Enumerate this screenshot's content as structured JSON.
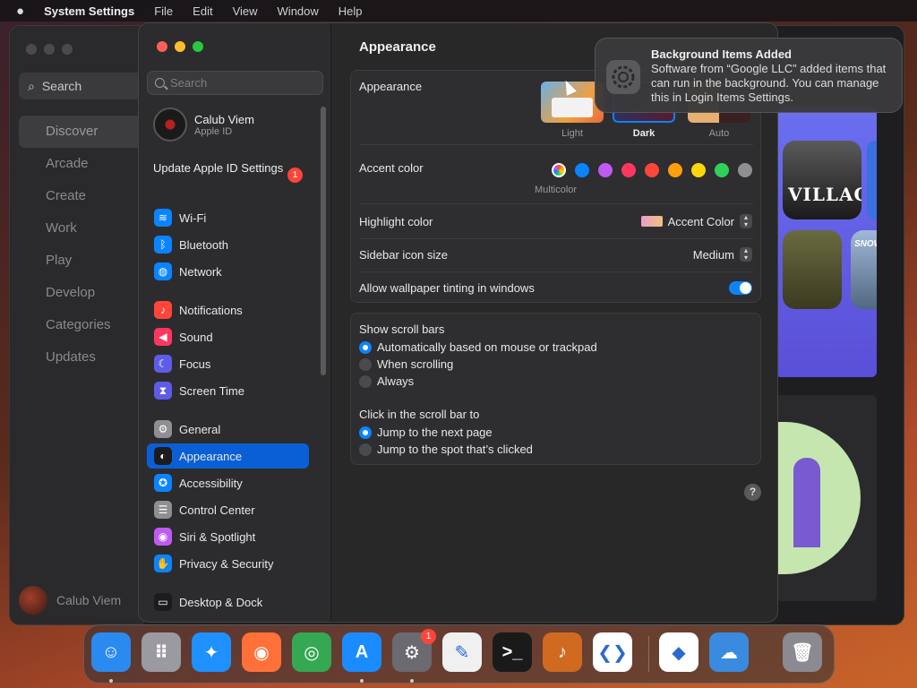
{
  "menubar": {
    "app_name": "System Settings",
    "items": [
      "File",
      "Edit",
      "View",
      "Window",
      "Help"
    ]
  },
  "store": {
    "search_label": "Search",
    "nav": [
      "Discover",
      "Arcade",
      "Create",
      "Work",
      "Play",
      "Develop",
      "Categories",
      "Updates"
    ],
    "active": "Discover",
    "user_name": "Calub Viem",
    "tile_village": "VILLAGE",
    "tile_snow": "SNOW"
  },
  "sidebar": {
    "search_placeholder": "Search",
    "user_name": "Calub Viem",
    "user_sub": "Apple ID",
    "update_label": "Update Apple ID Settings",
    "update_badge": "1",
    "items": [
      {
        "label": "Wi-Fi",
        "icon": "wifi-icon",
        "color": "#0a84ff"
      },
      {
        "label": "Bluetooth",
        "icon": "bluetooth-icon",
        "color": "#0a84ff"
      },
      {
        "label": "Network",
        "icon": "globe-icon",
        "color": "#0a84ff"
      },
      {
        "label": "Notifications",
        "icon": "bell-icon",
        "color": "#ff453a"
      },
      {
        "label": "Sound",
        "icon": "speaker-icon",
        "color": "#ff375f"
      },
      {
        "label": "Focus",
        "icon": "moon-icon",
        "color": "#5e5ce6"
      },
      {
        "label": "Screen Time",
        "icon": "hourglass-icon",
        "color": "#5e5ce6"
      },
      {
        "label": "General",
        "icon": "gear-icon",
        "color": "#8e8e93"
      },
      {
        "label": "Appearance",
        "icon": "appearance-icon",
        "color": "#1c1c1e"
      },
      {
        "label": "Accessibility",
        "icon": "accessibility-icon",
        "color": "#0a84ff"
      },
      {
        "label": "Control Center",
        "icon": "control-center-icon",
        "color": "#8e8e93"
      },
      {
        "label": "Siri & Spotlight",
        "icon": "siri-icon",
        "color": "#bf5af2"
      },
      {
        "label": "Privacy & Security",
        "icon": "hand-icon",
        "color": "#0a84ff"
      },
      {
        "label": "Desktop & Dock",
        "icon": "dock-icon",
        "color": "#1c1c1e"
      }
    ],
    "selected": "Appearance"
  },
  "content": {
    "title": "Appearance",
    "appearance_label": "Appearance",
    "themes": [
      "Light",
      "Dark",
      "Auto"
    ],
    "selected_theme": "Dark",
    "accent_label": "Accent color",
    "accent_selected": "Multicolor",
    "accent_colors": [
      "#0a84ff",
      "#bf5af2",
      "#ff375f",
      "#ff453a",
      "#ff9f0a",
      "#ffd60a",
      "#30d158",
      "#8e8e93"
    ],
    "highlight_label": "Highlight color",
    "highlight_value": "Accent Color",
    "icon_size_label": "Sidebar icon size",
    "icon_size_value": "Medium",
    "tinting_label": "Allow wallpaper tinting in windows",
    "tinting_on": true,
    "scroll_label": "Show scroll bars",
    "scroll_options": [
      "Automatically based on mouse or trackpad",
      "When scrolling",
      "Always"
    ],
    "scroll_selected": 0,
    "click_label": "Click in the scroll bar to",
    "click_options": [
      "Jump to the next page",
      "Jump to the spot that’s clicked"
    ],
    "click_selected": 0,
    "help": "?"
  },
  "notification": {
    "title": "Background Items Added",
    "body": "Software from “Google LLC” added items that can run in the background. You can manage this in Login Items Settings."
  },
  "dock": {
    "items": [
      {
        "name": "Finder",
        "icon": "finder-icon",
        "color": "#2a8af0",
        "glyph": "☺",
        "running": true
      },
      {
        "name": "Launchpad",
        "icon": "launchpad-icon",
        "color": "#9a9aa0",
        "glyph": "⠿",
        "running": false
      },
      {
        "name": "Safari",
        "icon": "safari-icon",
        "color": "#1e90ff",
        "glyph": "✦",
        "running": false
      },
      {
        "name": "Firefox",
        "icon": "firefox-icon",
        "color": "#ff7139",
        "glyph": "◉",
        "running": false
      },
      {
        "name": "Chrome",
        "icon": "chrome-icon",
        "color": "#34a853",
        "glyph": "◎",
        "running": false
      },
      {
        "name": "App Store",
        "icon": "app-store-icon",
        "color": "#1a8cff",
        "glyph": "A",
        "running": true
      },
      {
        "name": "System Settings",
        "icon": "system-settings-icon",
        "color": "#6a6a70",
        "glyph": "⚙",
        "running": true,
        "badge": "1"
      },
      {
        "name": "TextEdit",
        "icon": "textedit-icon",
        "color": "#f0f0f0",
        "glyph": "✎",
        "running": false
      },
      {
        "name": "Terminal",
        "icon": "terminal-icon",
        "color": "#1a1a1a",
        "glyph": ">_",
        "running": false
      },
      {
        "name": "GarageBand",
        "icon": "garageband-icon",
        "color": "#d06a20",
        "glyph": "♪",
        "running": false
      },
      {
        "name": "VS Code",
        "icon": "vscode-icon",
        "color": "#ffffff",
        "glyph": "❮❯",
        "running": false
      },
      {
        "name": "Visual Studio",
        "icon": "visual-studio-icon",
        "color": "#ffffff",
        "glyph": "◆",
        "running": false
      },
      {
        "name": "Weather",
        "icon": "weather-icon",
        "color": "#3a8ae0",
        "glyph": "☁",
        "running": false
      },
      {
        "name": "Trash",
        "icon": "trash-icon",
        "color": "#8a8a90",
        "glyph": "🗑",
        "running": false
      }
    ]
  }
}
